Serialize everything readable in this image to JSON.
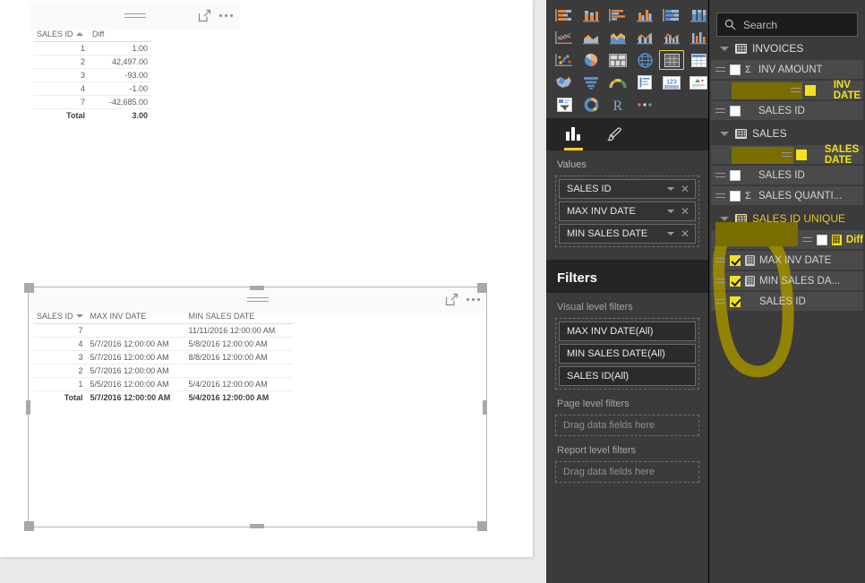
{
  "visual_one": {
    "name": "Diff by SALES ID table",
    "columns": [
      {
        "label": "SALES ID",
        "sort": "asc",
        "align": "num"
      },
      {
        "label": "Diff",
        "sort": "none",
        "align": "num"
      }
    ],
    "rows": [
      [
        "1",
        "1.00"
      ],
      [
        "2",
        "42,497.00"
      ],
      [
        "3",
        "-93.00"
      ],
      [
        "4",
        "-1.00"
      ],
      [
        "7",
        "-42,685.00"
      ]
    ],
    "total_row": [
      "Total",
      "3.00"
    ]
  },
  "visual_two": {
    "name": "MAX INV DATE / MIN SALES DATE table",
    "columns": [
      {
        "label": "SALES ID",
        "sort": "desc",
        "align": "num"
      },
      {
        "label": "MAX INV DATE",
        "sort": "none",
        "align": "txt"
      },
      {
        "label": "MIN SALES DATE",
        "sort": "none",
        "align": "txt"
      }
    ],
    "rows": [
      [
        "7",
        "",
        "11/11/2016 12:00:00 AM"
      ],
      [
        "4",
        "5/7/2016 12:00:00 AM",
        "5/8/2016 12:00:00 AM"
      ],
      [
        "3",
        "5/7/2016 12:00:00 AM",
        "8/8/2016 12:00:00 AM"
      ],
      [
        "2",
        "5/7/2016 12:00:00 AM",
        ""
      ],
      [
        "1",
        "5/5/2016 12:00:00 AM",
        "5/4/2016 12:00:00 AM"
      ]
    ],
    "total_row": [
      "Total",
      "5/7/2016 12:00:00 AM",
      "5/4/2016 12:00:00 AM"
    ],
    "selected": true
  },
  "viz_pane": {
    "gallery": [
      "stacked-bar-chart-icon",
      "stacked-column-chart-icon",
      "clustered-bar-chart-icon",
      "clustered-column-chart-icon",
      "hundred-percent-stacked-bar-chart-icon",
      "hundred-percent-stacked-column-chart-icon",
      "line-chart-icon",
      "area-chart-icon",
      "stacked-area-chart-icon",
      "line-stacked-column-chart-icon",
      "line-clustered-column-chart-icon",
      "ribbon-chart-icon",
      "scatter-chart-icon",
      "pie-chart-icon",
      "treemap-icon",
      "map-icon",
      "table-icon",
      "matrix-icon",
      "filled-map-icon",
      "funnel-chart-icon",
      "gauge-chart-icon",
      "multi-row-card-icon",
      "card-icon",
      "kpi-icon",
      "slicer-icon",
      "donut-chart-icon",
      "r-script-visual-icon",
      "more-visuals-icon"
    ],
    "selected_gallery_index": 16,
    "tabs": [
      {
        "name": "fields-tab",
        "icon": "bar-chart-icon",
        "active": true
      },
      {
        "name": "format-tab",
        "icon": "paintbrush-icon",
        "active": false
      }
    ],
    "values_label": "Values",
    "values_fields": [
      "SALES ID",
      "MAX INV DATE",
      "MIN SALES DATE"
    ],
    "filters_title": "Filters",
    "visual_level_label": "Visual level filters",
    "visual_level_filters": [
      "MAX INV DATE(All)",
      "MIN SALES DATE(All)",
      "SALES ID(All)"
    ],
    "page_level_label": "Page level filters",
    "page_level_placeholder": "Drag data fields here",
    "report_level_label": "Report level filters",
    "report_level_placeholder": "Drag data fields here"
  },
  "fields_pane": {
    "search_placeholder": "Search",
    "tables": [
      {
        "name": "INVOICES",
        "highlight": false,
        "fields": [
          {
            "label": "INV AMOUNT",
            "checked": false,
            "aggregate": true,
            "calc": false,
            "marked": false
          },
          {
            "label": "INV DATE",
            "checked": false,
            "aggregate": false,
            "calc": false,
            "marked": true
          },
          {
            "label": "SALES ID",
            "checked": false,
            "aggregate": false,
            "calc": false,
            "marked": false
          }
        ]
      },
      {
        "name": "SALES",
        "highlight": false,
        "fields": [
          {
            "label": "SALES DATE",
            "checked": false,
            "aggregate": false,
            "calc": false,
            "marked": true
          },
          {
            "label": "SALES ID",
            "checked": false,
            "aggregate": false,
            "calc": false,
            "marked": false
          },
          {
            "label": "SALES QUANTI...",
            "checked": false,
            "aggregate": true,
            "calc": false,
            "marked": false
          }
        ]
      },
      {
        "name": "SALES ID UNIQUE",
        "highlight": true,
        "fields": [
          {
            "label": "Diff",
            "checked": false,
            "aggregate": false,
            "calc": true,
            "marked": true
          },
          {
            "label": "MAX INV DATE",
            "checked": true,
            "aggregate": false,
            "calc": true,
            "marked": false
          },
          {
            "label": "MIN SALES DA...",
            "checked": true,
            "aggregate": false,
            "calc": true,
            "marked": false
          },
          {
            "label": "SALES ID",
            "checked": true,
            "aggregate": false,
            "calc": false,
            "marked": false
          }
        ]
      }
    ]
  },
  "annotation": {
    "name": "yellow-ink-loop",
    "color": "#9a8a00",
    "description": "hand-drawn highlighter loop around SALES ID UNIQUE fields"
  },
  "colors": {
    "accent_yellow": "#f2d025",
    "pane_bg": "#3b3b3b",
    "pane_dark": "#252525",
    "canvas_bg": "#e9e9e9",
    "field_row": "#4a4a4a",
    "highlight_olive": "#7a6d00"
  }
}
